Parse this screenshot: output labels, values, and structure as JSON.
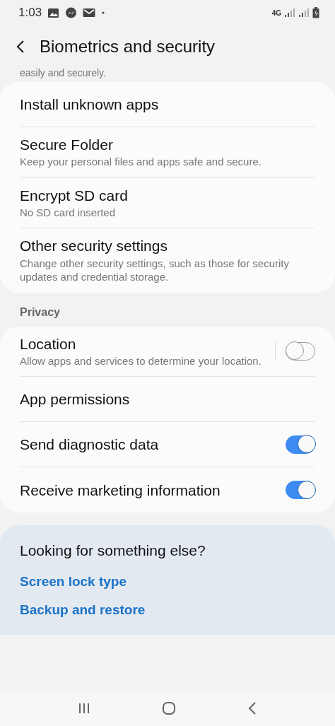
{
  "status_bar": {
    "time": "1:03",
    "network": "4G"
  },
  "header": {
    "title": "Biometrics and security"
  },
  "intro_text": "easily and securely.",
  "sections": [
    {
      "items": [
        {
          "kind": "plain",
          "title": "Install unknown apps"
        },
        {
          "kind": "plain",
          "title": "Secure Folder",
          "subtitle": "Keep your personal files and apps safe and secure."
        },
        {
          "kind": "plain",
          "title": "Encrypt SD card",
          "subtitle": "No SD card inserted"
        },
        {
          "kind": "plain",
          "title": "Other security settings",
          "subtitle": "Change other security settings, such as those for security updates and credential storage."
        }
      ]
    },
    {
      "header": "Privacy",
      "items": [
        {
          "kind": "toggle",
          "title": "Location",
          "subtitle": "Allow apps and services to determine your location.",
          "on": false
        },
        {
          "kind": "plain",
          "title": "App permissions"
        },
        {
          "kind": "toggle",
          "title": "Send diagnostic data",
          "on": true
        },
        {
          "kind": "toggle",
          "title": "Receive marketing information",
          "on": true
        }
      ]
    }
  ],
  "suggestions": {
    "title": "Looking for something else?",
    "links": [
      "Screen lock type",
      "Backup and restore"
    ]
  }
}
